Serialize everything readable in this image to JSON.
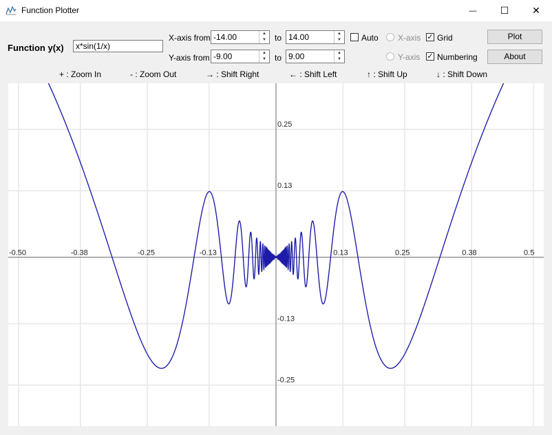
{
  "window": {
    "title": "Function Plotter",
    "minimize": "—",
    "maximize": "☐",
    "close": "✕"
  },
  "function": {
    "label": "Function y(x)",
    "value": "x*sin(1/x)"
  },
  "xaxis": {
    "label_from": "X-axis from",
    "from": "-14.00",
    "label_to": "to",
    "to": "14.00"
  },
  "yaxis": {
    "label_from": "Y-axis from",
    "from": "-9.00",
    "label_to": "to",
    "to": "9.00"
  },
  "options": {
    "auto": "Auto",
    "radio_x": "X-axis",
    "radio_y": "Y-axis",
    "grid": "Grid",
    "numbering": "Numbering"
  },
  "buttons": {
    "plot": "Plot",
    "about": "About"
  },
  "hints": {
    "zoom_in": "+ : Zoom In",
    "zoom_out": "- : Zoom Out",
    "shift_right": "→ : Shift Right",
    "shift_left": "← : Shift Left",
    "shift_up": "↑ : Shift Up",
    "shift_down": "↓ : Shift Down"
  },
  "colors": {
    "curve": "#1c1ca8",
    "grid": "#e6e6e6",
    "axis": "#808080"
  },
  "chart_data": {
    "type": "line",
    "function": "x*sin(1/x)",
    "xlim": [
      -0.52,
      0.52
    ],
    "ylim": [
      -0.33,
      0.34
    ],
    "x_ticks": [
      -0.5,
      -0.38,
      -0.25,
      -0.13,
      0.13,
      0.25,
      0.38,
      0.5
    ],
    "x_tick_labels": [
      "-0.50",
      "-0.38",
      "-0.25",
      "-0.13",
      "0.13",
      "0.25",
      "0.38",
      "0.5"
    ],
    "y_ticks": [
      0.25,
      0.13,
      -0.13,
      -0.25
    ],
    "y_tick_labels": [
      "0.25",
      "0.13",
      "-0.13",
      "-0.25"
    ],
    "grid": true
  }
}
